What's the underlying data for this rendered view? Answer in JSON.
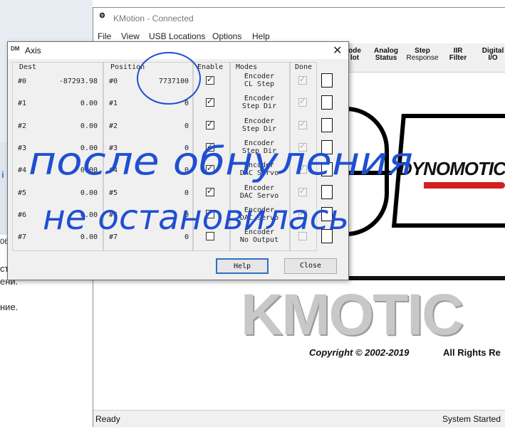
{
  "background_doc": {
    "fragment_1": "ст",
    "fragment_2": "ени.",
    "fragment_3": "ние.",
    "fragment_4": "i",
    "fragment_5": "06"
  },
  "kmotion": {
    "title": "KMotion - Connected",
    "menu": [
      "File",
      "View",
      "USB Locations",
      "Options",
      "Help"
    ],
    "toolbar": [
      {
        "line1": "ode",
        "line2": "lot"
      },
      {
        "line1": "Analog",
        "line2": "Status"
      },
      {
        "line1": "Step",
        "line2": "Response"
      },
      {
        "line1": "IIR",
        "line2": "Filter"
      },
      {
        "line1": "Digital",
        "line2": "I/O"
      }
    ],
    "logo_text": "DYNOMOTIC",
    "big_text": "KMOTIC",
    "copyright": "Copyright © 2002-2019",
    "rights": "All Rights Re",
    "status_left": "Ready",
    "status_right": "System Started"
  },
  "axis": {
    "title": "Axis",
    "close_glyph": "✕",
    "icon_text": "DM",
    "headers": {
      "dest": "Dest",
      "position": "Position",
      "enable": "Enable",
      "modes": "Modes",
      "done": "Done"
    },
    "rows": [
      {
        "dest_label": "#0",
        "dest_value": "-87293.98",
        "pos_label": "#0",
        "pos_value": "7737100",
        "enabled": true,
        "mode1": "Encoder",
        "mode2": "CL Step",
        "done": true
      },
      {
        "dest_label": "#1",
        "dest_value": "0.00",
        "pos_label": "#1",
        "pos_value": "0",
        "enabled": true,
        "mode1": "Encoder",
        "mode2": "Step Dir",
        "done": true
      },
      {
        "dest_label": "#2",
        "dest_value": "0.00",
        "pos_label": "#2",
        "pos_value": "0",
        "enabled": true,
        "mode1": "Encoder",
        "mode2": "Step Dir",
        "done": true
      },
      {
        "dest_label": "#3",
        "dest_value": "0.00",
        "pos_label": "#3",
        "pos_value": "0",
        "enabled": true,
        "mode1": "Encoder",
        "mode2": "Step Dir",
        "done": true
      },
      {
        "dest_label": "#4",
        "dest_value": "0.00",
        "pos_label": "#4",
        "pos_value": "0",
        "enabled": true,
        "mode1": "Encoder",
        "mode2": "DAC Servo",
        "done": true
      },
      {
        "dest_label": "#5",
        "dest_value": "0.00",
        "pos_label": "#5",
        "pos_value": "0",
        "enabled": true,
        "mode1": "Encoder",
        "mode2": "DAC Servo",
        "done": true
      },
      {
        "dest_label": "#6",
        "dest_value": "0.00",
        "pos_label": "#6",
        "pos_value": "0",
        "enabled": true,
        "mode1": "Encoder",
        "mode2": "DAC Servo",
        "done": true
      },
      {
        "dest_label": "#7",
        "dest_value": "0.00",
        "pos_label": "#7",
        "pos_value": "0",
        "enabled": false,
        "mode1": "Encoder",
        "mode2": "No Output",
        "done": false
      }
    ],
    "help_label": "Help",
    "close_label": "Close"
  },
  "annotation": {
    "line1": "после обнуления",
    "line2": "не остановилась",
    "color": "#1f4fd1"
  }
}
